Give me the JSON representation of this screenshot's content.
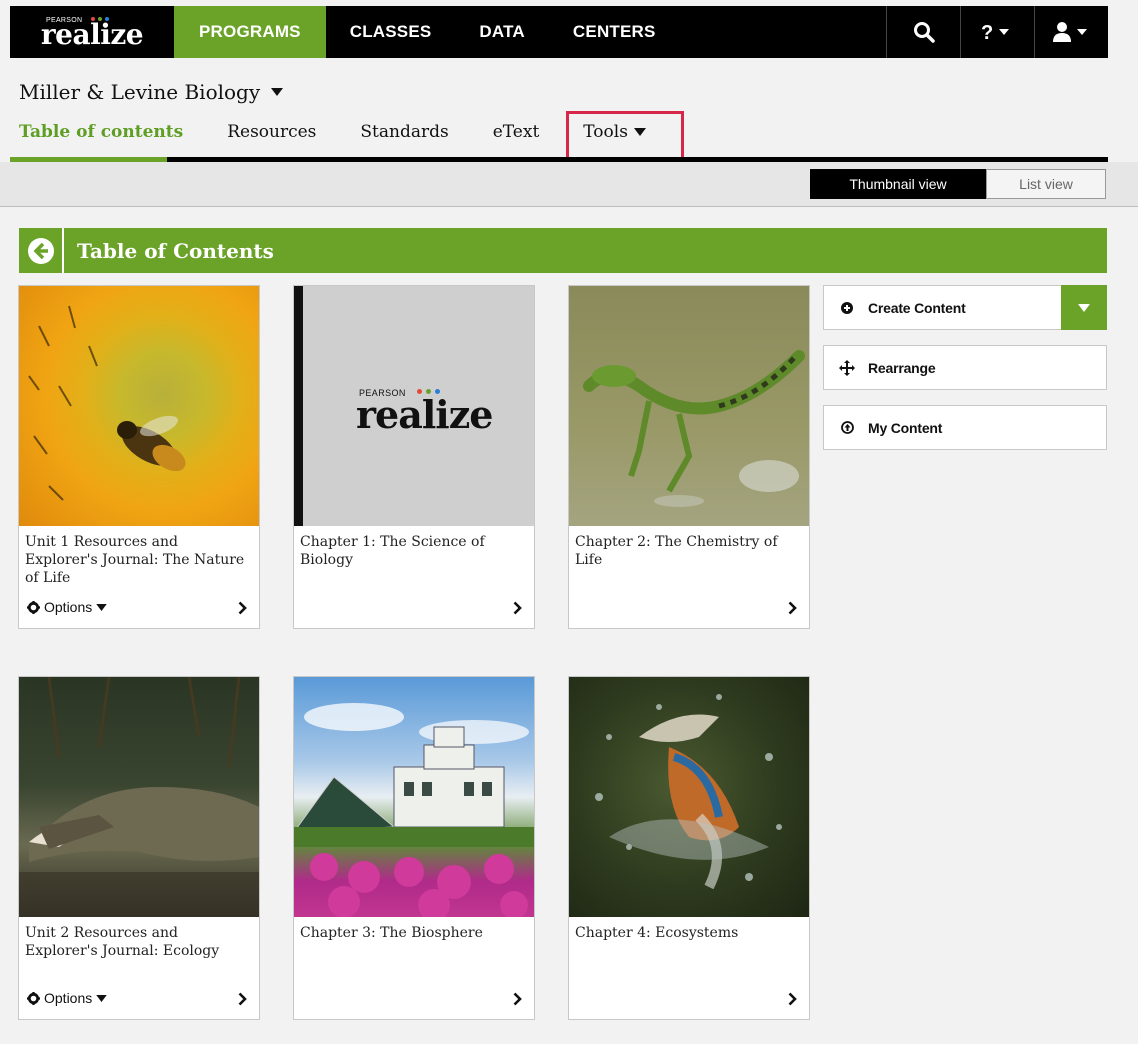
{
  "brand": {
    "pearson": "PEARSON",
    "name": "realize",
    "tm": "."
  },
  "topnav": [
    {
      "label": "PROGRAMS",
      "active": true
    },
    {
      "label": "CLASSES",
      "active": false
    },
    {
      "label": "DATA",
      "active": false
    },
    {
      "label": "CENTERS",
      "active": false
    }
  ],
  "icons": {
    "search": "search-icon",
    "help": "help-icon",
    "user": "user-icon"
  },
  "program": {
    "title": "Miller & Levine Biology"
  },
  "subnav": [
    {
      "label": "Table of contents",
      "active": true
    },
    {
      "label": "Resources"
    },
    {
      "label": "Standards"
    },
    {
      "label": "eText"
    },
    {
      "label": "Tools"
    }
  ],
  "view_toggle": {
    "thumbnail": "Thumbnail view",
    "list": "List view",
    "selected": "thumbnail"
  },
  "toc": {
    "title": "Table of Contents"
  },
  "cards": [
    {
      "caption": "Unit 1 Resources and Explorer's Journal: The Nature of Life",
      "options": "Options",
      "image": "sunflower-bee"
    },
    {
      "caption": "Chapter 1: The Science of Biology",
      "image": "realize-logo"
    },
    {
      "caption": "Chapter 2: The Chemistry of Life",
      "image": "lizard-running-on-water"
    },
    {
      "caption": "Unit 2 Resources and Explorer's Journal: Ecology",
      "options": "Options",
      "image": "crocodile"
    },
    {
      "caption": "Chapter 3: The Biosphere",
      "image": "biosphere-building"
    },
    {
      "caption": "Chapter 4: Ecosystems",
      "image": "kingfisher-fish"
    }
  ],
  "actions": {
    "create": "Create Content",
    "rearrange": "Rearrange",
    "my_content": "My Content"
  },
  "colors": {
    "accent": "#6aa328",
    "highlight": "#d6274a",
    "topbar": "#000000"
  }
}
